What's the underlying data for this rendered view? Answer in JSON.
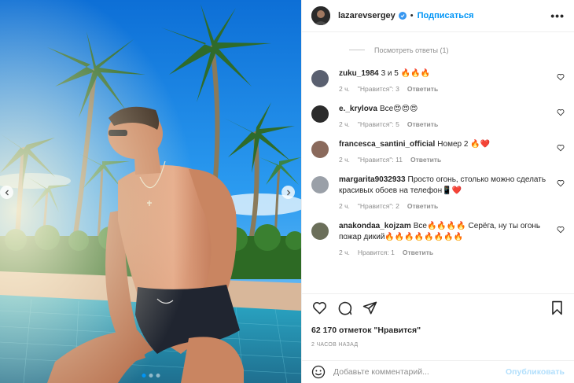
{
  "post": {
    "author": "lazarevsergey",
    "separator": "•",
    "follow_label": "Подписаться",
    "more_label": "•••"
  },
  "view_replies": "Посмотреть ответы (1)",
  "comments": [
    {
      "username": "zuku_1984",
      "text": "3 и 5 🔥🔥🔥",
      "time": "2 ч.",
      "likes": "\"Нравится\": 3",
      "reply": "Ответить",
      "avatar_color": "#5a6070"
    },
    {
      "username": "e._krylova",
      "text": "Все😍😍😍",
      "time": "2 ч.",
      "likes": "\"Нравится\": 5",
      "reply": "Ответить",
      "avatar_color": "#2b2b2b"
    },
    {
      "username": "francesca_santini_official",
      "text": "Номер 2 🔥❤️",
      "time": "2 ч.",
      "likes": "\"Нравится\": 11",
      "reply": "Ответить",
      "avatar_color": "#8a6a5c"
    },
    {
      "username": "margarita9032933",
      "text": "Просто огонь, столько можно сделать красивых обоев на телефон📱❤️",
      "time": "2 ч.",
      "likes": "\"Нравится\": 2",
      "reply": "Ответить",
      "avatar_color": "#9aa0a8"
    },
    {
      "username": "anakondaa_kojzam",
      "text": "Все🔥🔥🔥🔥 Серёга, ну ты огонь пожар дикий🔥🔥🔥🔥🔥🔥🔥🔥",
      "time": "2 ч.",
      "likes": "Нравится: 1",
      "reply": "Ответить",
      "avatar_color": "#6b6f5a"
    }
  ],
  "likes_count": "62 170 отметок \"Нравится\"",
  "time_ago": "2 ЧАСОВ НАЗАД",
  "add_comment": {
    "placeholder": "Добавьте комментарий...",
    "publish_label": "Опубликовать"
  },
  "colors": {
    "accent": "#0095f6",
    "publish_disabled": "#b2dffc",
    "muted": "#8e8e8e"
  },
  "icons": {
    "header": [
      "verified-badge-icon",
      "more-options-icon"
    ],
    "actions": [
      "heart-icon",
      "comment-icon",
      "share-icon",
      "bookmark-icon"
    ],
    "photo": [
      "prev-arrow-icon",
      "next-arrow-icon"
    ],
    "composer": [
      "emoji-icon"
    ]
  }
}
